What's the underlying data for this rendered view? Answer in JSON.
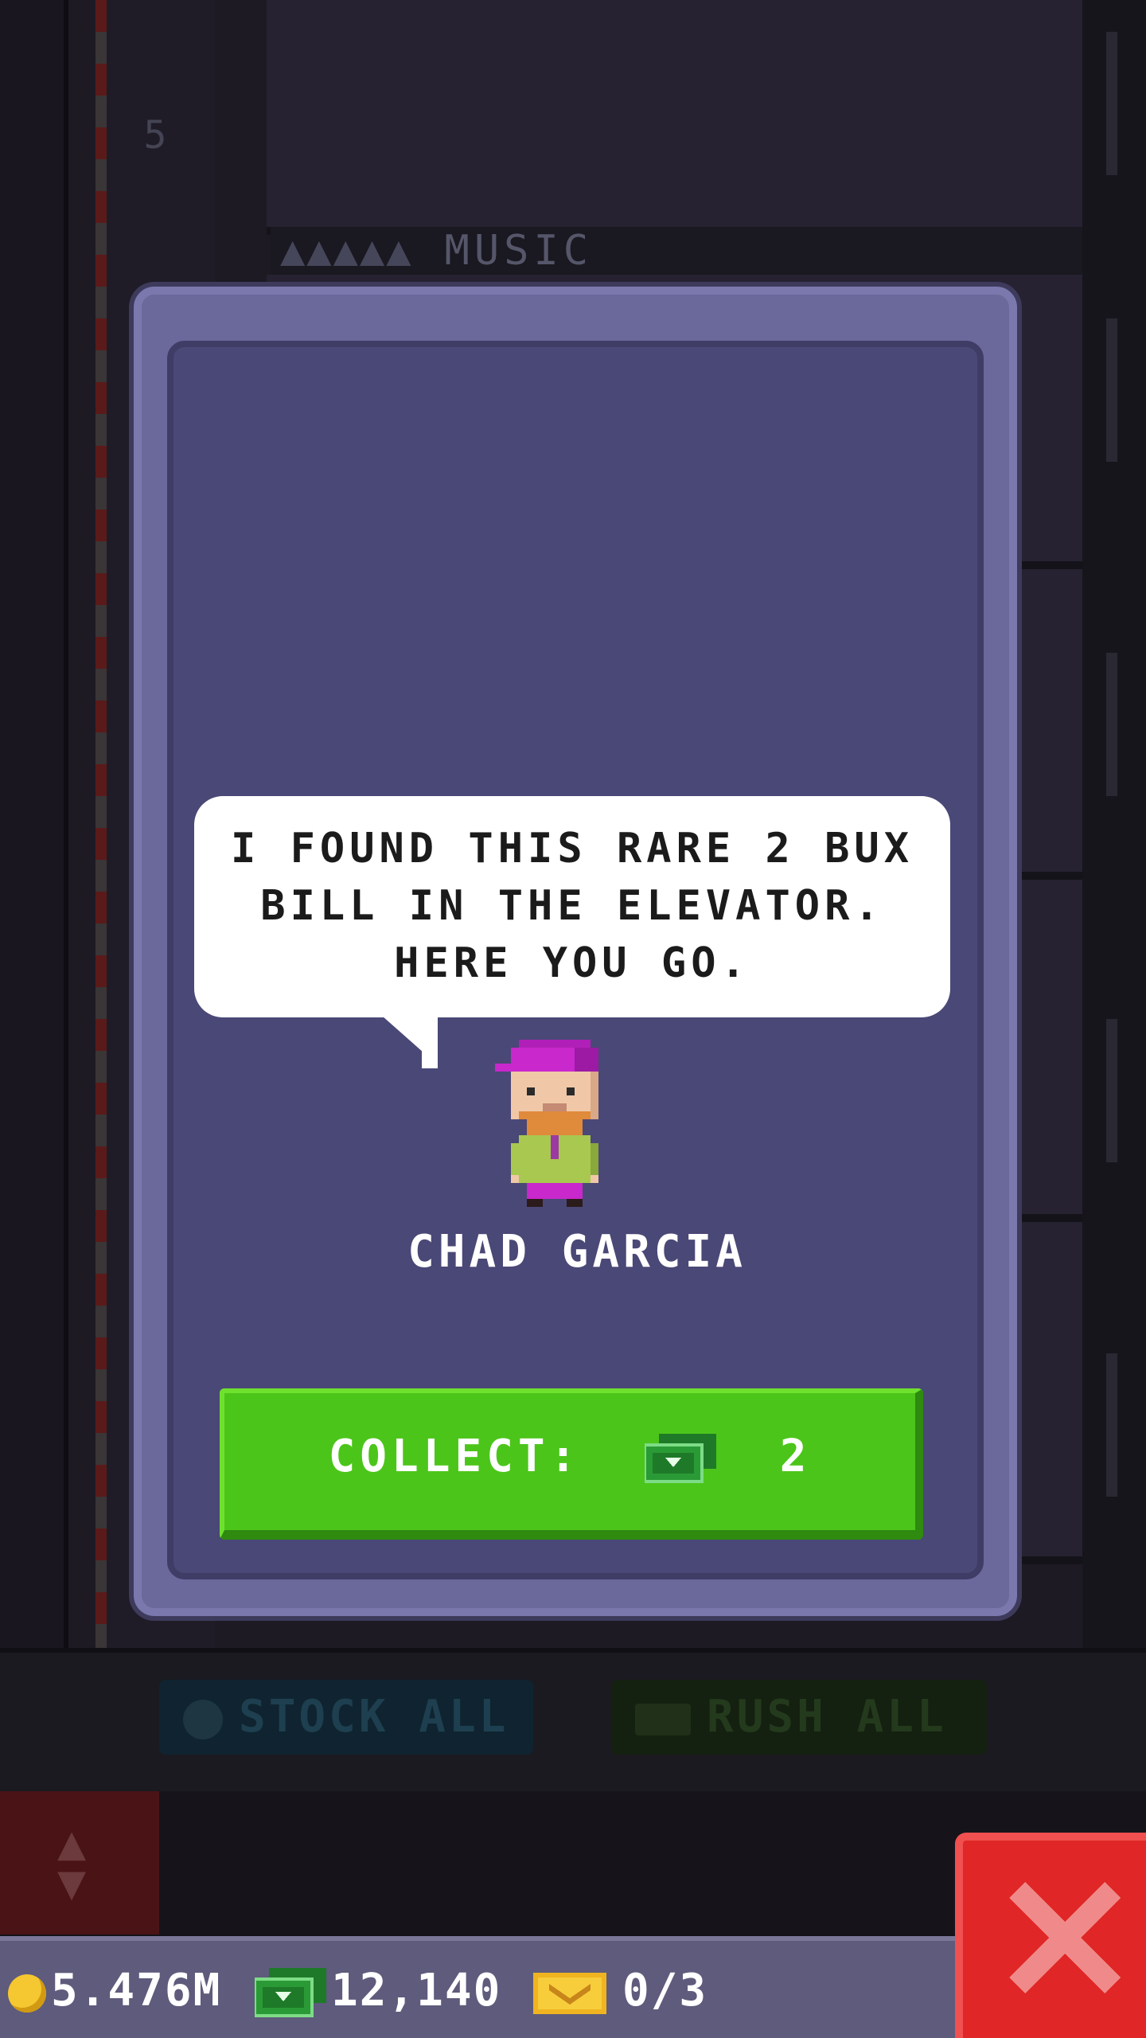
{
  "background": {
    "floor_name": "MUSIC",
    "floor_number": "5",
    "stock_all_label": "STOCK ALL",
    "rush_all_label": "RUSH ALL"
  },
  "dialog": {
    "message": "I FOUND THIS RARE 2 BUX BILL IN THE ELEVATOR. HERE YOU GO.",
    "character_name": "CHAD GARCIA",
    "collect_label": "COLLECT:",
    "collect_amount": "2",
    "collect_icon": "bux-icon"
  },
  "status": {
    "coins": "5.476M",
    "bux": "12,140",
    "tickets": "0/3"
  },
  "colors": {
    "modal": "#6b689c",
    "modal_inner": "#4a4876",
    "collect_button": "#4cc51a",
    "close_button": "#e02626",
    "status_bar": "#5e5b7c"
  }
}
